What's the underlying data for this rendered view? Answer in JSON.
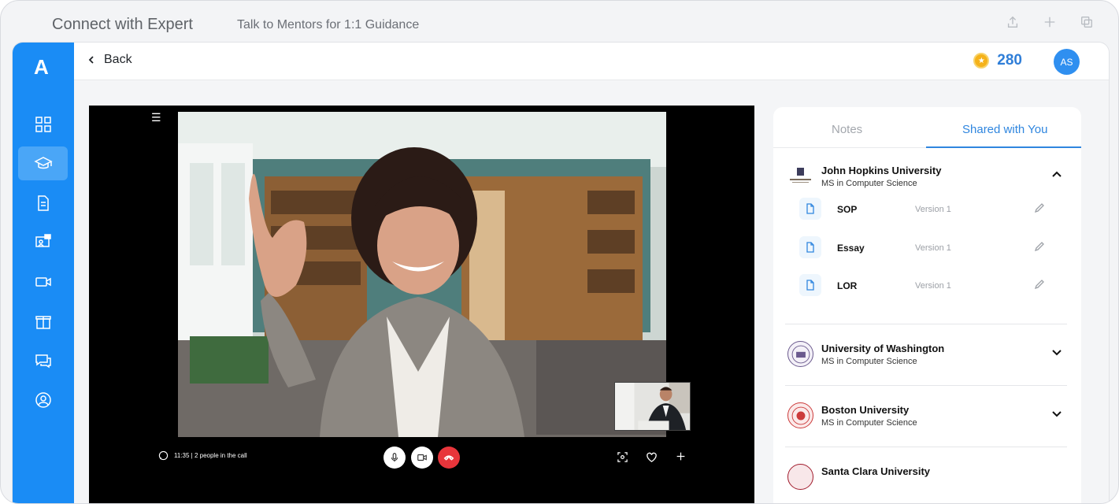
{
  "app": {
    "title": "Connect with Expert",
    "subtitle": "Talk to Mentors for 1:1 Guidance"
  },
  "top_icons": [
    "share-icon",
    "plus-icon",
    "duplicate-icon"
  ],
  "sidebar": {
    "logo": "A",
    "items": [
      {
        "name": "dashboard-icon",
        "active": false
      },
      {
        "name": "graduation-cap-icon",
        "active": true
      },
      {
        "name": "document-icon",
        "active": false
      },
      {
        "name": "mentor-session-icon",
        "active": false
      },
      {
        "name": "video-camera-icon",
        "active": false
      },
      {
        "name": "gift-icon",
        "active": false
      },
      {
        "name": "chat-icon",
        "active": false
      },
      {
        "name": "profile-icon",
        "active": false
      }
    ]
  },
  "header": {
    "back_label": "Back",
    "coins": "280",
    "avatar_initials": "AS"
  },
  "call": {
    "meta": "11:35 | 2 people in the call"
  },
  "panel": {
    "tabs": [
      "Notes",
      "Shared with You"
    ],
    "active_tab": "Shared with You",
    "universities": [
      {
        "name": "John Hopkins University",
        "program": "MS in Computer Science",
        "expanded": true,
        "docs": [
          {
            "name": "SOP",
            "version": "Version 1"
          },
          {
            "name": "Essay",
            "version": "Version 1"
          },
          {
            "name": "LOR",
            "version": "Version 1"
          }
        ]
      },
      {
        "name": "University of Washington",
        "program": "MS in Computer Science",
        "expanded": false
      },
      {
        "name": "Boston University",
        "program": "MS in Computer Science",
        "expanded": false
      },
      {
        "name": "Santa Clara University",
        "program": "",
        "expanded": false
      }
    ]
  },
  "colors": {
    "accent": "#1a8cf5",
    "tab_active": "#2f86df",
    "end_call": "#e8353b",
    "coin": "#f5b21a"
  }
}
